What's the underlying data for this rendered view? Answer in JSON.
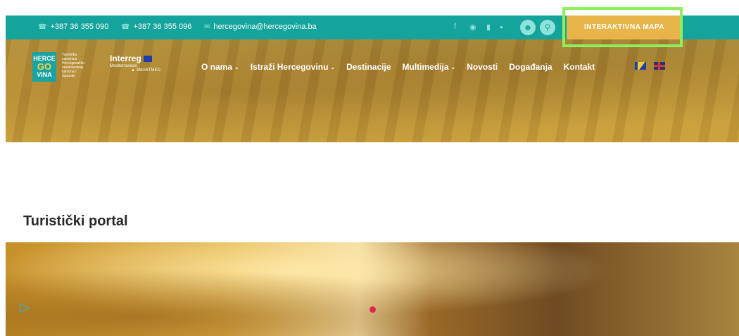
{
  "topbar": {
    "phone1": "+387 36 355 090",
    "phone2": "+387 36 355 096",
    "email": "hercegovina@hercegovina.ba",
    "social_icons": [
      "facebook-icon",
      "instagram-icon",
      "youtube-icon"
    ],
    "cta_label": "INTERAKTIVNA MAPA"
  },
  "logo": {
    "line1": "HERCE",
    "line2": "GO",
    "line3": "VINA",
    "subtitle": "Turistička zajednica Hercegovačko-neretvanskog kantona / županije"
  },
  "partner_logo": {
    "title": "Interreg",
    "subtitle": "Mediterranean",
    "project": "SMARTMED"
  },
  "nav": {
    "items": [
      {
        "label": "O nama",
        "has_dropdown": true
      },
      {
        "label": "Istraži Hercegovinu",
        "has_dropdown": true
      },
      {
        "label": "Destinacije",
        "has_dropdown": false
      },
      {
        "label": "Multimedija",
        "has_dropdown": true
      },
      {
        "label": "Novosti",
        "has_dropdown": false
      },
      {
        "label": "Događanja",
        "has_dropdown": false
      },
      {
        "label": "Kontakt",
        "has_dropdown": false
      }
    ]
  },
  "main": {
    "section_title": "Turistički portal"
  },
  "colors": {
    "topbar": "#14a49c",
    "cta": "#e8b54a",
    "highlight": "#8ff05c"
  }
}
